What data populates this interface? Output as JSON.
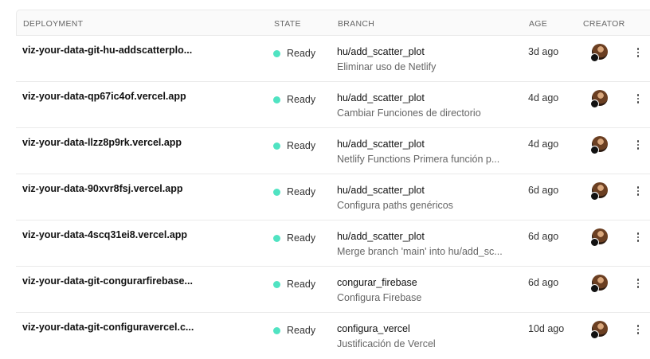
{
  "columns": {
    "deployment": "DEPLOYMENT",
    "state": "STATE",
    "branch": "BRANCH",
    "age": "AGE",
    "creator": "CREATOR"
  },
  "colors": {
    "ready_dot": "#50e3c2"
  },
  "rows": [
    {
      "deployment": "viz-your-data-git-hu-addscatterplo...",
      "state": "Ready",
      "branch": "hu/add_scatter_plot",
      "commit": "Eliminar uso de Netlify",
      "age": "3d ago"
    },
    {
      "deployment": "viz-your-data-qp67ic4of.vercel.app",
      "state": "Ready",
      "branch": "hu/add_scatter_plot",
      "commit": "Cambiar Funciones de directorio",
      "age": "4d ago"
    },
    {
      "deployment": "viz-your-data-llzz8p9rk.vercel.app",
      "state": "Ready",
      "branch": "hu/add_scatter_plot",
      "commit": "Netlify Functions Primera función p...",
      "age": "4d ago"
    },
    {
      "deployment": "viz-your-data-90xvr8fsj.vercel.app",
      "state": "Ready",
      "branch": "hu/add_scatter_plot",
      "commit": "Configura paths genéricos",
      "age": "6d ago"
    },
    {
      "deployment": "viz-your-data-4scq31ei8.vercel.app",
      "state": "Ready",
      "branch": "hu/add_scatter_plot",
      "commit": "Merge branch 'main' into hu/add_sc...",
      "age": "6d ago"
    },
    {
      "deployment": "viz-your-data-git-congurarfirebase...",
      "state": "Ready",
      "branch": "congurar_firebase",
      "commit": "Configura Firebase",
      "age": "6d ago"
    },
    {
      "deployment": "viz-your-data-git-configuravercel.c...",
      "state": "Ready",
      "branch": "configura_vercel",
      "commit": "Justificación de Vercel",
      "age": "10d ago"
    }
  ]
}
